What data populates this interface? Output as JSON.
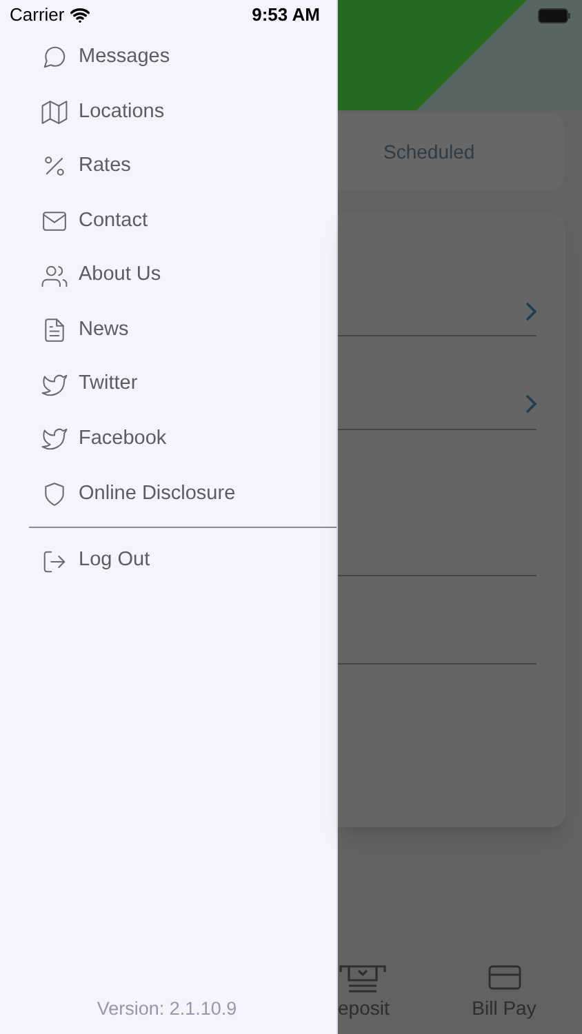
{
  "status_bar": {
    "carrier": "Carrier",
    "time": "9:53 AM"
  },
  "menu": {
    "items": [
      {
        "label": "Messages",
        "kind": "chat"
      },
      {
        "label": "Locations",
        "kind": "map"
      },
      {
        "label": "Rates",
        "kind": "percent"
      },
      {
        "label": "Contact",
        "kind": "mail"
      },
      {
        "label": "About Us",
        "kind": "people"
      },
      {
        "label": "News",
        "kind": "news"
      },
      {
        "label": "Twitter",
        "kind": "bird"
      },
      {
        "label": "Facebook",
        "kind": "bird"
      },
      {
        "label": "Online Disclosure",
        "kind": "shield"
      }
    ],
    "footer_items": [
      {
        "label": "Log Out",
        "kind": "logout"
      }
    ],
    "version": "Version: 2.1.10.9"
  },
  "background": {
    "tab": "Scheduled",
    "tab_bar": [
      {
        "label": "eposit",
        "kind": "deposit"
      },
      {
        "label": "Bill Pay",
        "kind": "card"
      }
    ]
  }
}
